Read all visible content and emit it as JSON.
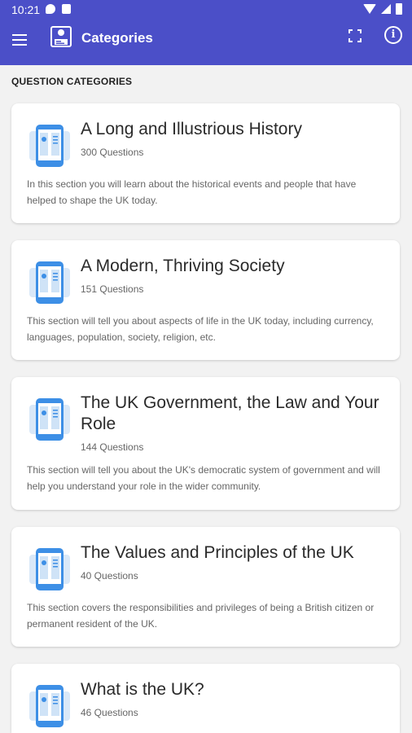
{
  "status_bar": {
    "time": "10:21"
  },
  "app_bar": {
    "title": "Categories"
  },
  "section_header": "QUESTION CATEGORIES",
  "categories": [
    {
      "title": "A Long and Illustrious History",
      "count": "300 Questions",
      "description": "In this section you will learn about the historical events and people that have helped to shape the UK today."
    },
    {
      "title": "A Modern, Thriving Society",
      "count": "151 Questions",
      "description": "This section will tell you about aspects of life in the UK today, including currency, languages, population, society, religion, etc."
    },
    {
      "title": "The UK Government, the Law and Your Role",
      "count": "144 Questions",
      "description": "This section will tell you about the UK's democratic system of government and will help you understand your role in the wider community."
    },
    {
      "title": "The Values and Principles of the UK",
      "count": "40 Questions",
      "description": "This section covers the responsibilities and privileges of being a British citizen or permanent resident of the UK."
    },
    {
      "title": "What is the UK?",
      "count": "46 Questions",
      "description": ""
    }
  ],
  "colors": {
    "app_bar": "#4b4fc8",
    "icon_blue": "#3d8fe6",
    "background": "#f2f2f2"
  },
  "icons": {
    "menu": "hamburger-menu-icon",
    "logo": "app-logo-icon",
    "fullscreen": "fullscreen-icon",
    "info": "info-icon",
    "category": "phone-book-icon"
  }
}
